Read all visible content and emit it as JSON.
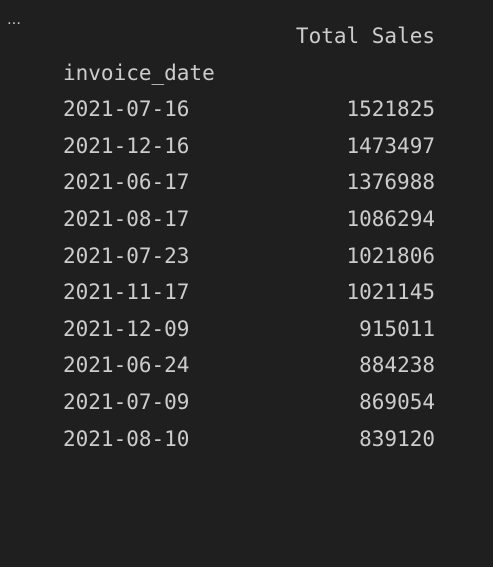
{
  "more_actions": "…",
  "table": {
    "column_header": "Total Sales",
    "index_name": "invoice_date",
    "rows": [
      {
        "date": "2021-07-16",
        "value": "1521825"
      },
      {
        "date": "2021-12-16",
        "value": "1473497"
      },
      {
        "date": "2021-06-17",
        "value": "1376988"
      },
      {
        "date": "2021-08-17",
        "value": "1086294"
      },
      {
        "date": "2021-07-23",
        "value": "1021806"
      },
      {
        "date": "2021-11-17",
        "value": "1021145"
      },
      {
        "date": "2021-12-09",
        "value": "915011"
      },
      {
        "date": "2021-06-24",
        "value": "884238"
      },
      {
        "date": "2021-07-09",
        "value": "869054"
      },
      {
        "date": "2021-08-10",
        "value": "839120"
      }
    ]
  }
}
